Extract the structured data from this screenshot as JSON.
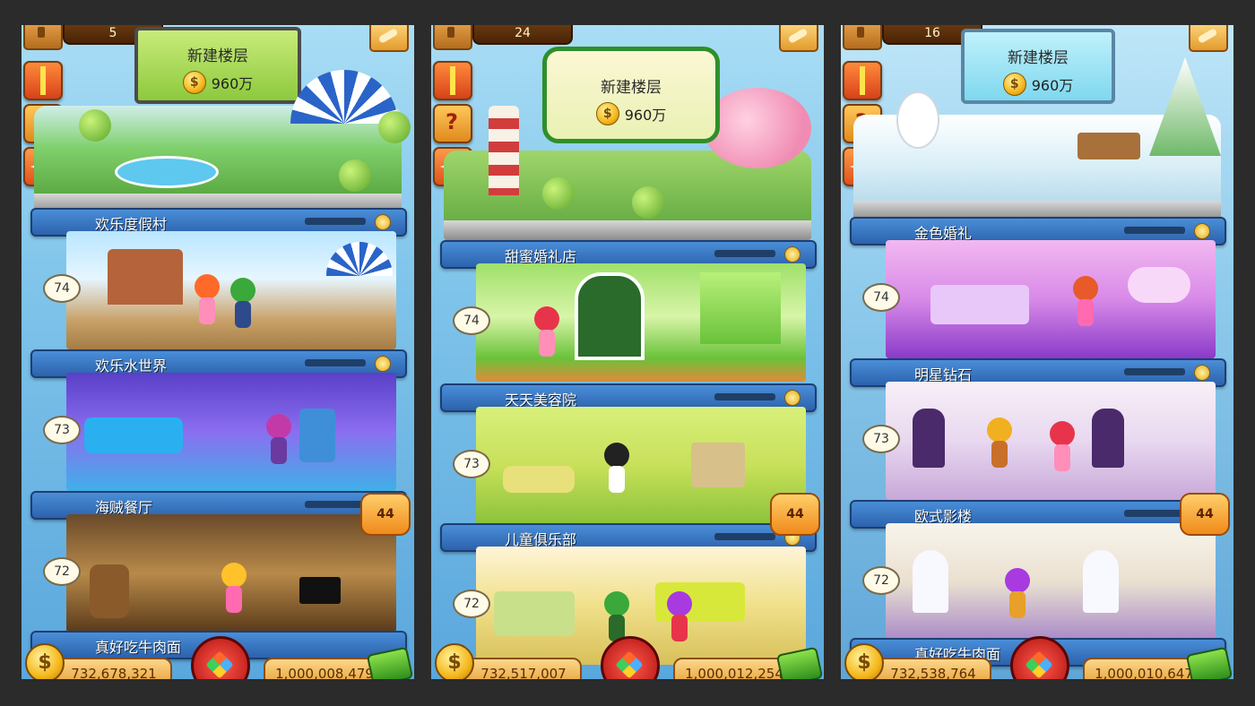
{
  "panels": [
    {
      "level": "5",
      "billboard": {
        "title": "新建楼层",
        "cost": "960万"
      },
      "floors": [
        {
          "name": "欢乐度假村",
          "number": ""
        },
        {
          "name": "欢乐水世界",
          "number": "74"
        },
        {
          "name": "海贼餐厅",
          "number": "73"
        },
        {
          "name": "真好吃牛肉面",
          "number": "72"
        }
      ],
      "messages": "44",
      "coins": "732,678,321",
      "cash": "1,000,008,479"
    },
    {
      "level": "24",
      "billboard": {
        "title": "新建楼层",
        "cost": "960万"
      },
      "floors": [
        {
          "name": "甜蜜婚礼店",
          "number": ""
        },
        {
          "name": "天天美容院",
          "number": "74"
        },
        {
          "name": "儿童俱乐部",
          "number": "73"
        },
        {
          "name": "",
          "number": "72"
        }
      ],
      "messages": "44",
      "coins": "732,517,007",
      "cash": "1,000,012,254"
    },
    {
      "level": "16",
      "billboard": {
        "title": "新建楼层",
        "cost": "960万"
      },
      "floors": [
        {
          "name": "金色婚礼",
          "number": ""
        },
        {
          "name": "明星钻石",
          "number": "74"
        },
        {
          "name": "欧式影楼",
          "number": "73"
        },
        {
          "name": "真好吃牛肉面",
          "number": "72"
        }
      ],
      "messages": "44",
      "coins": "732,538,764",
      "cash": "1,000,010,647"
    }
  ],
  "coin_symbol": "$",
  "theme": {
    "banner": "#2c62ad",
    "accent": "#f4b61a",
    "background": "#2b2b2b"
  }
}
